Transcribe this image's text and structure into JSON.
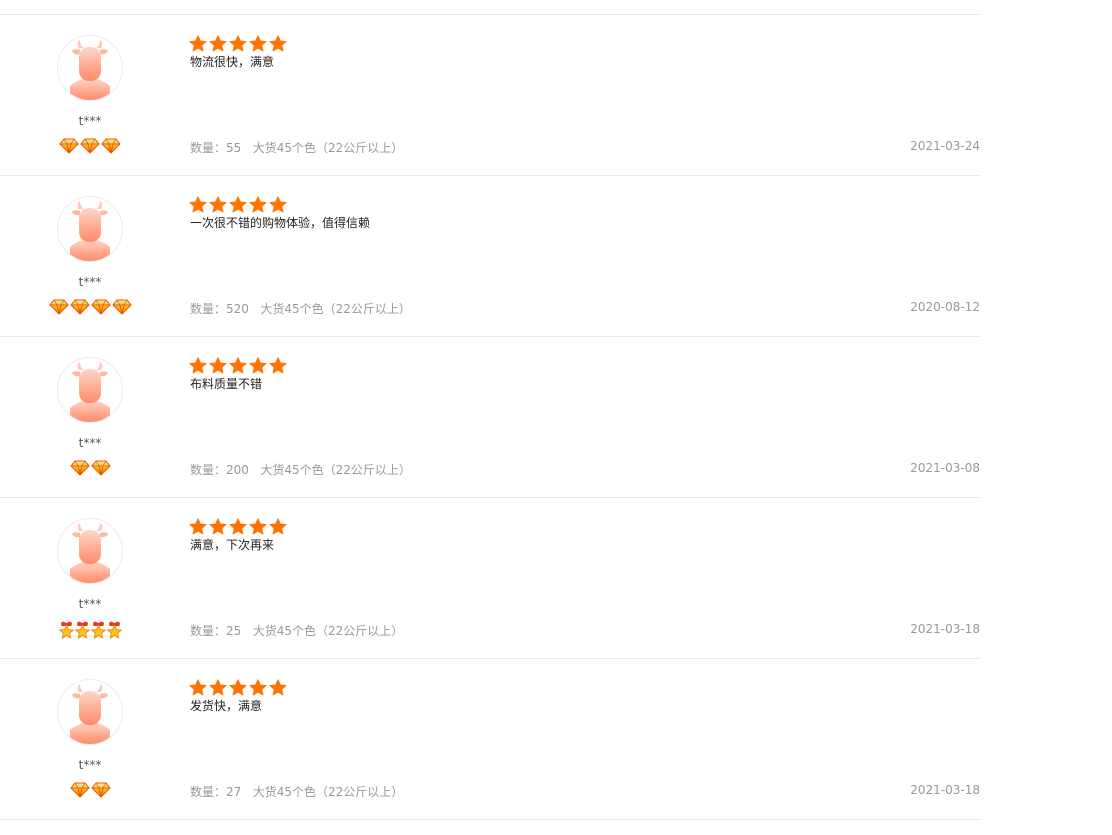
{
  "reviews": [
    {
      "user": "t***",
      "rating": 5,
      "text": "物流很快，满意",
      "quantity_label": "数量：",
      "quantity": "55",
      "spec": "大货45个色（22公斤以上）",
      "date": "2021-03-24",
      "badge_type": "diamond",
      "badge_count": 3
    },
    {
      "user": "t***",
      "rating": 5,
      "text": "一次很不错的购物体验，值得信赖",
      "quantity_label": "数量：",
      "quantity": "520",
      "spec": "大货45个色（22公斤以上）",
      "date": "2020-08-12",
      "badge_type": "diamond",
      "badge_count": 4
    },
    {
      "user": "t***",
      "rating": 5,
      "text": "布料质量不错",
      "quantity_label": "数量：",
      "quantity": "200",
      "spec": "大货45个色（22公斤以上）",
      "date": "2021-03-08",
      "badge_type": "diamond",
      "badge_count": 2
    },
    {
      "user": "t***",
      "rating": 5,
      "text": "满意，下次再来",
      "quantity_label": "数量：",
      "quantity": "25",
      "spec": "大货45个色（22公斤以上）",
      "date": "2021-03-18",
      "badge_type": "medal",
      "badge_count": 4
    },
    {
      "user": "t***",
      "rating": 5,
      "text": "发货快，满意",
      "quantity_label": "数量：",
      "quantity": "27",
      "spec": "大货45个色（22公斤以上）",
      "date": "2021-03-18",
      "badge_type": "diamond",
      "badge_count": 2
    }
  ],
  "colors": {
    "star": "#ff7300",
    "avatar": "#ff9a80",
    "meta_text": "#999999",
    "divider": "#e8e8e8"
  },
  "icons": {
    "star": "star-icon",
    "avatar": "cow-avatar-icon",
    "diamond": "diamond-icon",
    "medal": "crown-medal-icon"
  }
}
